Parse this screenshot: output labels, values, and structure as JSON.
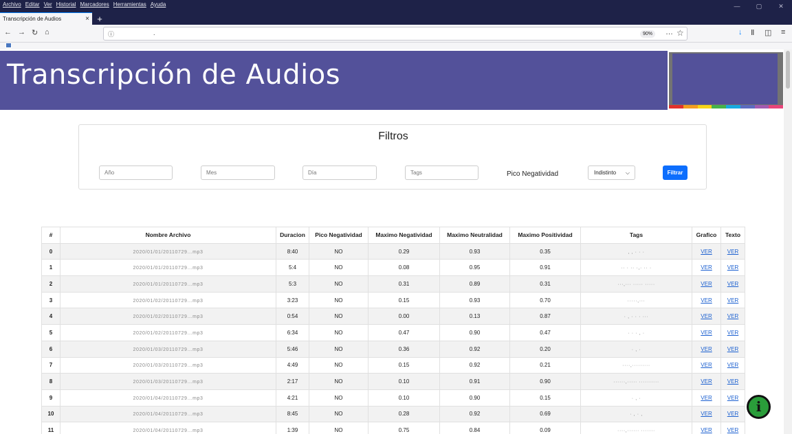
{
  "browser": {
    "menu": [
      "Archivo",
      "Editar",
      "Ver",
      "Historial",
      "Marcadores",
      "Herramientas",
      "Ayuda"
    ],
    "tab_title": "Transcripción de Audios",
    "tab_close": "×",
    "new_tab": "+",
    "url": ".",
    "zoom": "90%",
    "window_controls": [
      "—",
      "▢",
      "✕"
    ]
  },
  "header": {
    "title": "Transcripción de Audios"
  },
  "logo": {
    "stripe_colors": [
      "#e2312d",
      "#f39d1f",
      "#f7d417",
      "#45b24a",
      "#17a9e0",
      "#5c6bc0",
      "#a25bb1",
      "#e8457a"
    ]
  },
  "filters": {
    "title": "Filtros",
    "year_placeholder": "Año",
    "month_placeholder": "Mes",
    "day_placeholder": "Día",
    "tags_placeholder": "Tags",
    "pico_label": "Pico Negatividad",
    "pico_selected": "Indistinto",
    "submit_label": "Filtrar"
  },
  "table": {
    "headers": [
      "#",
      "Nombre Archivo",
      "Duracion",
      "Pico Negatividad",
      "Maximo Negatividad",
      "Maximo Neutralidad",
      "Maximo Positividad",
      "Tags",
      "Grafico",
      "Texto"
    ],
    "rows": [
      {
        "idx": "0",
        "name": "2020/01/01/20110729…mp3",
        "dur": "8:40",
        "pico": "NO",
        "neg": "0.29",
        "neu": "0.93",
        "pos": "0.35",
        "tags": ", , ·  · ·",
        "g": "VER",
        "t": "VER"
      },
      {
        "idx": "1",
        "name": "2020/01/01/20110729…mp3",
        "dur": "5:4",
        "pico": "NO",
        "neg": "0.08",
        "neu": "0.95",
        "pos": "0.91",
        "tags": "·· · ·· ·,· ·· ·",
        "g": "VER",
        "t": "VER"
      },
      {
        "idx": "2",
        "name": "2020/01/01/20110729…mp3",
        "dur": "5:3",
        "pico": "NO",
        "neg": "0.31",
        "neu": "0.89",
        "pos": "0.31",
        "tags": "···,··· ····· ·····",
        "g": "VER",
        "t": "VER"
      },
      {
        "idx": "3",
        "name": "2020/01/02/20110729…mp3",
        "dur": "3:23",
        "pico": "NO",
        "neg": "0.15",
        "neu": "0.93",
        "pos": "0.70",
        "tags": "·····,···",
        "g": "VER",
        "t": "VER"
      },
      {
        "idx": "4",
        "name": "2020/01/02/20110729…mp3",
        "dur": "0:54",
        "pico": "NO",
        "neg": "0.00",
        "neu": "0.13",
        "pos": "0.87",
        "tags": "· , ·  · ·  ···",
        "g": "VER",
        "t": "VER"
      },
      {
        "idx": "5",
        "name": "2020/01/02/20110729…mp3",
        "dur": "6:34",
        "pico": "NO",
        "neg": "0.47",
        "neu": "0.90",
        "pos": "0.47",
        "tags": "·  · ·  ,  ·",
        "g": "VER",
        "t": "VER"
      },
      {
        "idx": "6",
        "name": "2020/01/03/20110729…mp3",
        "dur": "5:46",
        "pico": "NO",
        "neg": "0.36",
        "neu": "0.92",
        "pos": "0.20",
        "tags": "· ,  ·",
        "g": "VER",
        "t": "VER"
      },
      {
        "idx": "7",
        "name": "2020/01/03/20110729…mp3",
        "dur": "4:49",
        "pico": "NO",
        "neg": "0.15",
        "neu": "0.92",
        "pos": "0.21",
        "tags": "····,·········",
        "g": "VER",
        "t": "VER"
      },
      {
        "idx": "8",
        "name": "2020/01/03/20110729…mp3",
        "dur": "2:17",
        "pico": "NO",
        "neg": "0.10",
        "neu": "0.91",
        "pos": "0.90",
        "tags": "······,····· ··········",
        "g": "VER",
        "t": "VER"
      },
      {
        "idx": "9",
        "name": "2020/01/04/20110729…mp3",
        "dur": "4:21",
        "pico": "NO",
        "neg": "0.10",
        "neu": "0.90",
        "pos": "0.15",
        "tags": "· , ·",
        "g": "VER",
        "t": "VER"
      },
      {
        "idx": "10",
        "name": "2020/01/04/20110729…mp3",
        "dur": "8:45",
        "pico": "NO",
        "neg": "0.28",
        "neu": "0.92",
        "pos": "0.69",
        "tags": "· , · ,",
        "g": "VER",
        "t": "VER"
      },
      {
        "idx": "11",
        "name": "2020/01/04/20110729…mp3",
        "dur": "1:39",
        "pico": "NO",
        "neg": "0.75",
        "neu": "0.84",
        "pos": "0.09",
        "tags": "····,······ ·······",
        "g": "VER",
        "t": "VER"
      }
    ]
  },
  "help_icon": "i"
}
